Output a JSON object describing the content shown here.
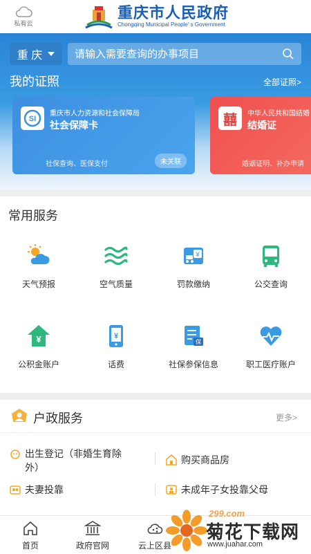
{
  "header": {
    "cloud_label": "私有云",
    "title": "重庆市人民政府",
    "subtitle": "Chongqing Municipal People' s Government"
  },
  "search": {
    "city": "重 庆",
    "placeholder": "请输入需要查询的办事项目"
  },
  "certificates": {
    "title": "我的证照",
    "all_link": "全部证照>",
    "cards": [
      {
        "issuer": "重庆市人力资源和社会保障局",
        "name": "社会保障卡",
        "desc": "社保查询、医保支付",
        "badge": "未关联",
        "color": "#3d8fe0"
      },
      {
        "issuer": "中华人民共和国结婚",
        "name": "结婚证",
        "desc": "婚姻证明、补办申请",
        "icon_text": "囍",
        "color": "#f05050"
      }
    ]
  },
  "common_services": {
    "title": "常用服务",
    "items": [
      {
        "label": "天气预报",
        "icon": "weather-icon"
      },
      {
        "label": "空气质量",
        "icon": "air-quality-icon"
      },
      {
        "label": "罚款缴纳",
        "icon": "fine-payment-icon"
      },
      {
        "label": "公交查询",
        "icon": "bus-icon"
      },
      {
        "label": "公积金账户",
        "icon": "housing-fund-icon"
      },
      {
        "label": "话费",
        "icon": "phone-bill-icon"
      },
      {
        "label": "社保参保信息",
        "icon": "social-insurance-icon"
      },
      {
        "label": "职工医疗账户",
        "icon": "medical-account-icon"
      }
    ]
  },
  "hukou": {
    "title": "户政服务",
    "more": "更多>",
    "items": [
      {
        "label": "出生登记（非婚生育除外）"
      },
      {
        "label": "购买商品房"
      },
      {
        "label": "夫妻投靠"
      },
      {
        "label": "未成年子女投靠父母"
      }
    ]
  },
  "bottom_nav": {
    "items": [
      {
        "label": "首页"
      },
      {
        "label": "政府官网"
      },
      {
        "label": "云上区县"
      }
    ]
  },
  "watermark": {
    "site": "299.com",
    "name": "菊花下载网",
    "url": "www.juahar.com"
  },
  "colors": {
    "brand_blue": "#1b5fb5",
    "band_blue": "#2a84d6",
    "card_red": "#f05050",
    "hukou_orange": "#f5a623"
  }
}
